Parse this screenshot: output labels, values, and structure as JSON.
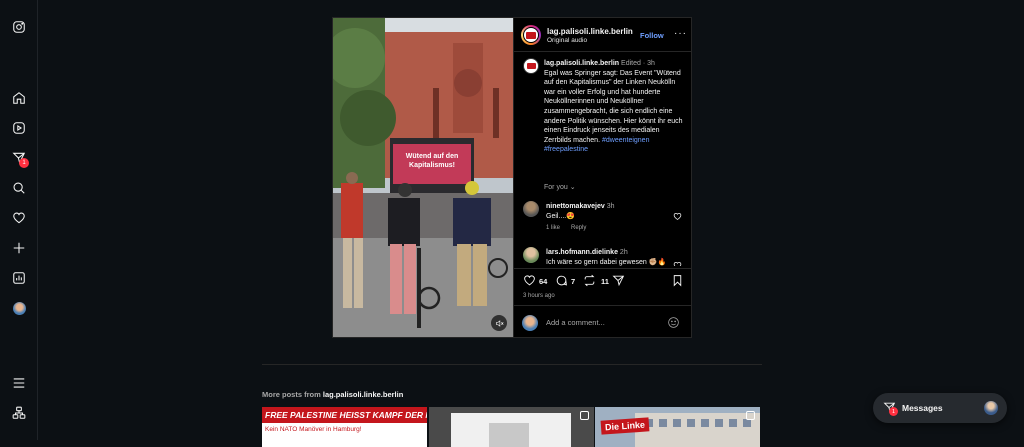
{
  "sidebar": {
    "items": [
      {
        "name": "instagram-icon"
      },
      {
        "name": "home-icon"
      },
      {
        "name": "reels-icon"
      },
      {
        "name": "messages-icon",
        "badge": "1"
      },
      {
        "name": "search-icon"
      },
      {
        "name": "notifications-icon"
      },
      {
        "name": "create-icon"
      },
      {
        "name": "dashboard-icon"
      },
      {
        "name": "profile-avatar"
      },
      {
        "name": "menu-icon"
      },
      {
        "name": "also-from-meta-icon"
      }
    ]
  },
  "post": {
    "video": {
      "sign_line1": "Wütend auf den",
      "sign_line2": "Kapitalismus!"
    },
    "header": {
      "username": "lag.palisoli.linke.berlin",
      "audio": "Original audio",
      "follow": "Follow",
      "more": "···"
    },
    "caption": {
      "username": "lag.palisoli.linke.berlin",
      "meta": "Edited · 3h",
      "text": "Egal was Springer sagt: Das Event \"Wütend auf den Kapitalismus\" der Linken Neukölln war ein voller Erfolg und hat hunderte Neuköllnerinnen und Neuköllner zusammengebracht, die sich endlich eine andere Politik wünschen. Hier könnt ihr euch einen Eindruck jenseits des medialen Zerrbilds machen.",
      "tags": "#dweenteignen #freepalestine"
    },
    "for_you": "For you",
    "comments": [
      {
        "username": "ninettomakavejev",
        "time": "3h",
        "text": "Geil....😍",
        "likes": "1 like",
        "reply": "Reply"
      },
      {
        "username": "lars.hofmann.dielinke",
        "time": "2h",
        "text": "Ich wäre so gern dabei gewesen ✊🏼🔥"
      }
    ],
    "actions": {
      "likes": "64",
      "comments": "7",
      "reposts": "11"
    },
    "time": "3 hours ago",
    "add_comment_placeholder": "Add a comment..."
  },
  "more_posts": {
    "label": "More posts from",
    "username": "lag.palisoli.linke.berlin",
    "thumbs": [
      {
        "headline": "FREE PALESTINE HEISST KAMPF DER NATO!",
        "sub": "Kein NATO Manöver in Hamburg!"
      },
      {},
      {
        "logo": "Die Linke"
      }
    ]
  },
  "messages": {
    "label": "Messages",
    "badge": "1"
  },
  "colors": {
    "background": "#0c1014",
    "link": "#6f9fff",
    "badge": "#ff3040",
    "brand_red": "#c4161c"
  }
}
